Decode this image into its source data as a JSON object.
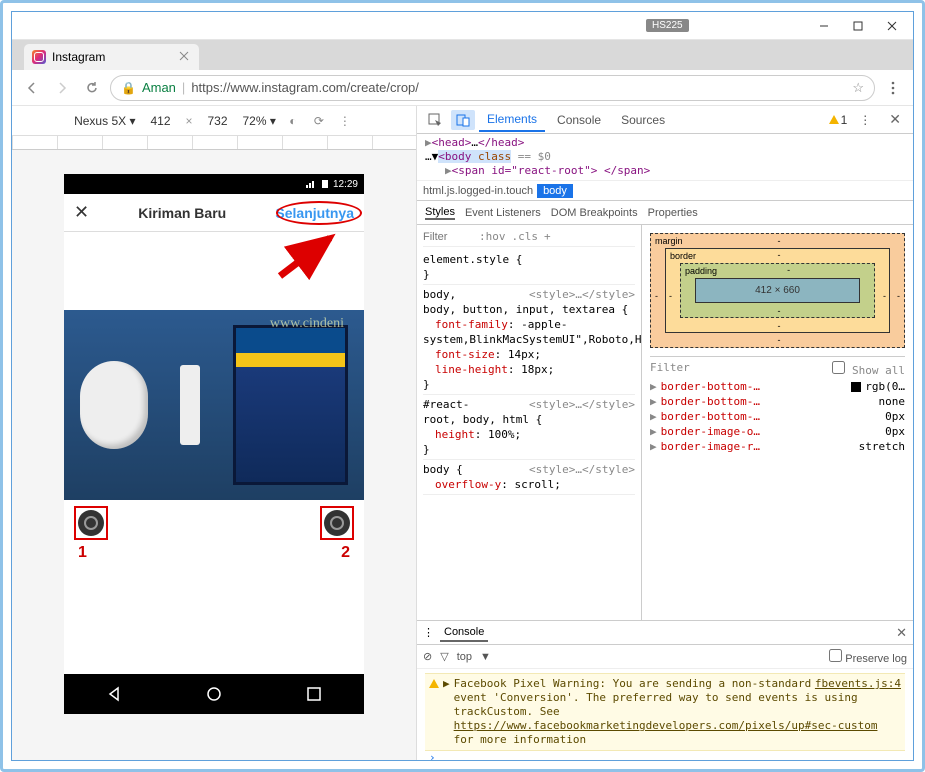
{
  "window": {
    "badge": "HS225",
    "tab_title": "Instagram"
  },
  "addressbar": {
    "secure_label": "Aman",
    "url": "https://www.instagram.com/create/crop/"
  },
  "device_toolbar": {
    "device": "Nexus 5X",
    "width": "412",
    "height": "732",
    "zoom": "72%"
  },
  "phone": {
    "clock": "12:29",
    "header_title": "Kiriman Baru",
    "next_label": "Selanjutnya",
    "watermark": "www.cindeni",
    "annot_1": "1",
    "annot_2": "2"
  },
  "devtools": {
    "tabs": {
      "elements": "Elements",
      "console": "Console",
      "sources": "Sources"
    },
    "warn_count": "1",
    "dom_line1_a": "<head>",
    "dom_line1_b": "</head>",
    "dom_line2_a": "<body ",
    "dom_line2_b": "class",
    "dom_line2_c": " == $0",
    "dom_line3": "<span id=\"react-root\"> </span>",
    "crumb1": "html.js.logged-in.touch",
    "crumb2": "body",
    "styles_tabs": {
      "styles": "Styles",
      "listeners": "Event Listeners",
      "dom": "DOM Breakpoints",
      "props": "Properties"
    },
    "filter_label": "Filter",
    "hov": ":hov",
    "cls": ".cls",
    "rule1_sel": "element.style {",
    "rule1_close": "}",
    "rule2_src": "<style>…</style>",
    "rule2_sel": "body, button, input, textarea {",
    "rule2_p1": "font-family",
    "rule2_v1": "-apple-system,BlinkMacSystemUI\",Roboto,Helvetica,serif",
    "rule2_p2": "font-size",
    "rule2_v2": "14px",
    "rule2_p3": "line-height",
    "rule2_v3": "18px",
    "rule3_src": "<style>…</style>",
    "rule3_sel": "#react-root, body, html {",
    "rule3_p1": "height",
    "rule3_v1": "100%",
    "rule4_src": "<style>…</style>",
    "rule4_sel": "body {",
    "rule4_p1": "overflow-y",
    "rule4_v1": "scroll",
    "boxmodel": {
      "margin": "margin",
      "border": "border",
      "padding": "padding",
      "dims": "412 × 660"
    },
    "computed_filter": "Filter",
    "computed_showall": "Show all",
    "computed": [
      {
        "name": "border-bottom-…",
        "val": "rgb(0…",
        "swatch": true
      },
      {
        "name": "border-bottom-…",
        "val": "none"
      },
      {
        "name": "border-bottom-…",
        "val": "0px"
      },
      {
        "name": "border-image-o…",
        "val": "0px"
      },
      {
        "name": "border-image-r…",
        "val": "stretch"
      }
    ],
    "console_tab": "Console",
    "console_filter_ctx": "top",
    "preserve_log": "Preserve log",
    "warn_msg": "Facebook Pixel Warning: You are sending a non-standard event 'Conversion'. The preferred way to send events is using trackCustom. See ",
    "warn_link": "https://www.facebookmarketingdevelopers.com/pixels/up#sec-custom",
    "warn_tail": " for more information",
    "warn_src": "fbevents.js:4"
  }
}
